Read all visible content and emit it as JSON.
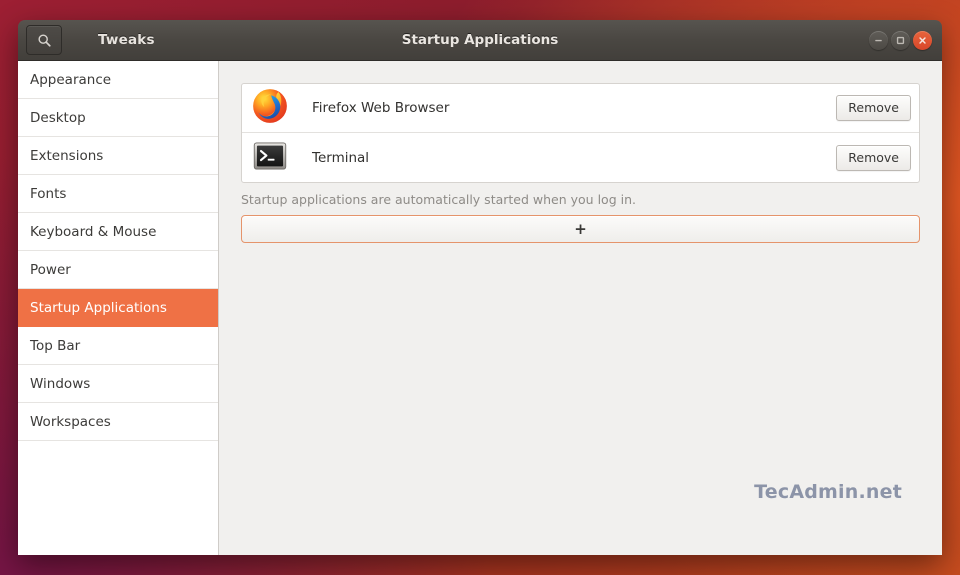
{
  "window": {
    "app_name": "Tweaks",
    "title": "Startup Applications",
    "search_icon": "search-icon",
    "controls": {
      "minimize_label": "minimize-icon",
      "maximize_label": "maximize-icon",
      "close_label": "close-icon"
    }
  },
  "sidebar": {
    "items": [
      {
        "label": "Appearance",
        "selected": false
      },
      {
        "label": "Desktop",
        "selected": false
      },
      {
        "label": "Extensions",
        "selected": false
      },
      {
        "label": "Fonts",
        "selected": false
      },
      {
        "label": "Keyboard & Mouse",
        "selected": false
      },
      {
        "label": "Power",
        "selected": false
      },
      {
        "label": "Startup Applications",
        "selected": true
      },
      {
        "label": "Top Bar",
        "selected": false
      },
      {
        "label": "Windows",
        "selected": false
      },
      {
        "label": "Workspaces",
        "selected": false
      }
    ]
  },
  "main": {
    "apps": [
      {
        "name": "Firefox Web Browser",
        "icon": "firefox-icon",
        "action_label": "Remove"
      },
      {
        "name": "Terminal",
        "icon": "terminal-icon",
        "action_label": "Remove"
      }
    ],
    "hint": "Startup applications are automatically started when you log in.",
    "add_button_label": "+"
  },
  "watermark": "TecAdmin.net",
  "colors": {
    "accent": "#ef7145",
    "titlebar": "#4a4742",
    "close_button": "#d8472a",
    "content_bg": "#f1f0ee",
    "focus_border": "#e5946b"
  }
}
